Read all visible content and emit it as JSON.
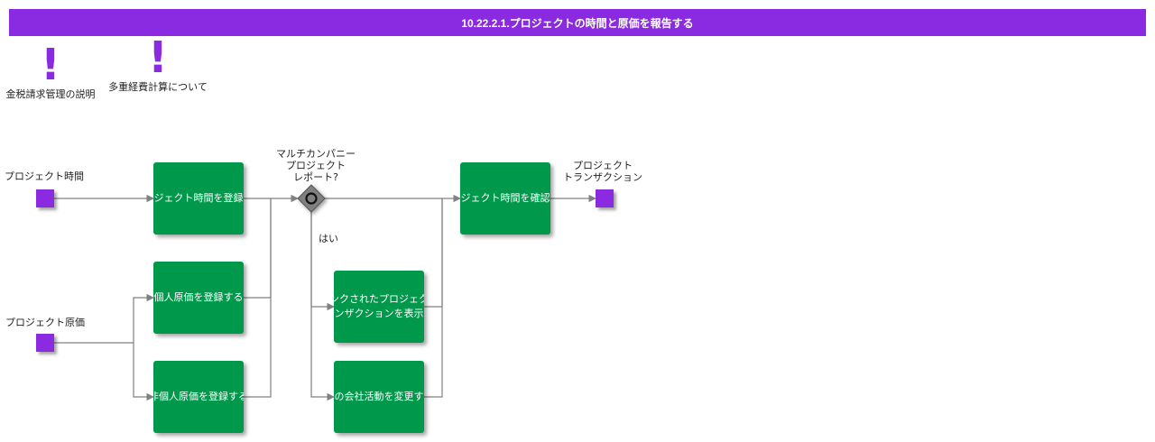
{
  "title": "10.22.2.1.プロジェクトの時間と原価を報告する",
  "notes": [
    {
      "label": "金税請求管理の説明"
    },
    {
      "label": "多重経費計算について"
    }
  ],
  "events": {
    "project_time": "プロジェクト時間",
    "project_cost": "プロジェクト原価",
    "project_transaction": "プロジェクト\nトランザクション"
  },
  "gateway": {
    "label": "マルチカンパニー\nプロジェクト\nレポート?",
    "yes_label": "はい"
  },
  "tasks": {
    "register_time": "ジェクト時間を登録",
    "register_personal_cost": "個人原価を登録する",
    "register_nonpersonal_cost": "非個人原価を登録する",
    "linked_line1": "ンクされたプロジェク",
    "linked_line2": "ンザクションを表示",
    "change_activity": "の会社活動を変更す",
    "confirm_time": "ジェクト時間を確認"
  },
  "colors": {
    "accent": "#8a2be2",
    "task": "#00994c",
    "gateway": "#808080",
    "connector": "#808080"
  }
}
